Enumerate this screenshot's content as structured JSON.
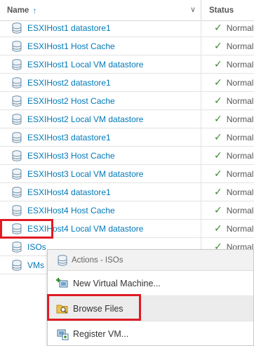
{
  "header": {
    "name_label": "Name",
    "sort_arrow": "↑",
    "dropdown_chevron": "∨",
    "status_label": "Status"
  },
  "rows": [
    {
      "name": "ESXIHost1 datastore1",
      "status": "Normal"
    },
    {
      "name": "ESXIHost1 Host Cache",
      "status": "Normal"
    },
    {
      "name": "ESXIHost1 Local VM datastore",
      "status": "Normal"
    },
    {
      "name": "ESXIHost2 datastore1",
      "status": "Normal"
    },
    {
      "name": "ESXIHost2 Host Cache",
      "status": "Normal"
    },
    {
      "name": "ESXIHost2 Local VM datastore",
      "status": "Normal"
    },
    {
      "name": "ESXIHost3 datastore1",
      "status": "Normal"
    },
    {
      "name": "ESXIHost3 Host Cache",
      "status": "Normal"
    },
    {
      "name": "ESXIHost3 Local VM datastore",
      "status": "Normal"
    },
    {
      "name": "ESXIHost4 datastore1",
      "status": "Normal"
    },
    {
      "name": "ESXIHost4 Host Cache",
      "status": "Normal"
    },
    {
      "name": "ESXIHost4 Local VM datastore",
      "status": "Normal"
    },
    {
      "name": "ISOs",
      "status": "Normal"
    },
    {
      "name": "VMs",
      "status": "Normal"
    }
  ],
  "context_menu": {
    "title": "Actions - ISOs",
    "items": [
      {
        "label": "New Virtual Machine...",
        "icon": "new-vm-icon"
      },
      {
        "label": "Browse Files",
        "icon": "folder-browse-icon"
      },
      {
        "label": "Register VM...",
        "icon": "register-vm-icon"
      }
    ]
  },
  "colors": {
    "link": "#0079b8",
    "check": "#3b8a2f",
    "highlight_box": "#e01b24"
  }
}
